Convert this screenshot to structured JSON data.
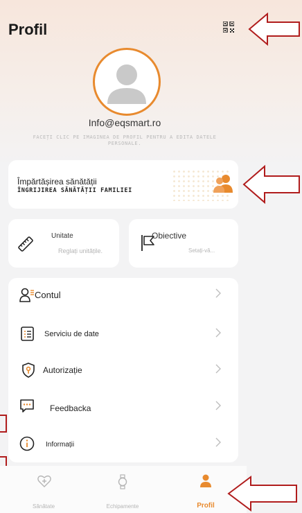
{
  "header": {
    "title": "Profil"
  },
  "profile": {
    "email": "Info@eqsmart.ro",
    "hint": "FACEȚI CLIC PE IMAGINEA DE PROFIL PENTRU A EDITA DATELE PERSONALE."
  },
  "share_card": {
    "title": "Împărtășirea sănătății",
    "subtitle": "ÎNGRIJIREA SĂNĂTĂȚII FAMILIEI"
  },
  "unit_card": {
    "title": "Unitate",
    "subtitle": "Reglați unitățile."
  },
  "objective_card": {
    "title": "Obiective",
    "subtitle": "Setați-vă..."
  },
  "menu": {
    "items": [
      {
        "label": "Contul"
      },
      {
        "label": "Serviciu de date"
      },
      {
        "label": "Autorizație"
      },
      {
        "label": "Feedbacka"
      },
      {
        "label": "Informații"
      }
    ]
  },
  "bottom_nav": {
    "items": [
      {
        "label": "Sănătate"
      },
      {
        "label": "Echipamente"
      },
      {
        "label": "Profil"
      }
    ]
  },
  "colors": {
    "accent": "#e88a2e",
    "annotation": "#b01c1c",
    "background": "#f3f3f4"
  }
}
